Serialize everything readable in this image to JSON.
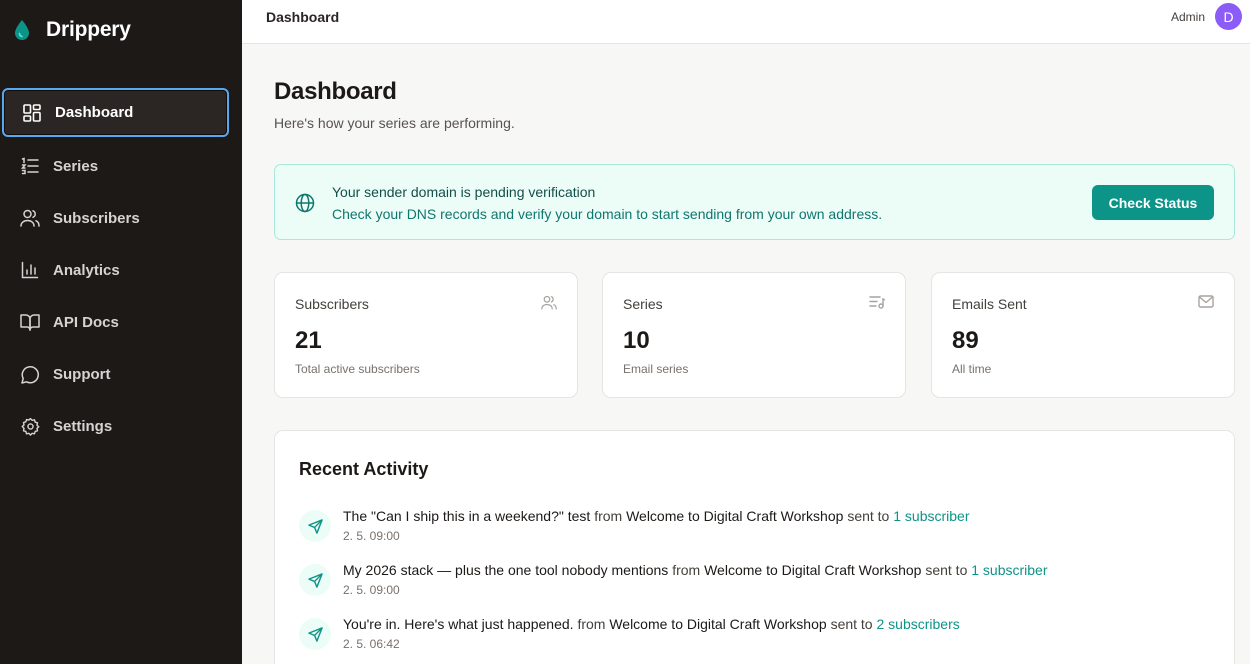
{
  "brand": {
    "name": "Drippery",
    "accent": "#0d9488"
  },
  "sidebar": {
    "items": [
      {
        "label": "Dashboard",
        "icon": "dashboard-grid-icon",
        "active": true
      },
      {
        "label": "Series",
        "icon": "list-ordered-icon"
      },
      {
        "label": "Subscribers",
        "icon": "users-icon"
      },
      {
        "label": "Analytics",
        "icon": "bar-chart-icon"
      },
      {
        "label": "API Docs",
        "icon": "book-open-icon"
      },
      {
        "label": "Support",
        "icon": "message-circle-icon"
      },
      {
        "label": "Settings",
        "icon": "gear-icon"
      }
    ]
  },
  "topbar": {
    "title": "Dashboard",
    "user_name": "Admin",
    "avatar_initial": "D",
    "avatar_color": "#8b5cf6"
  },
  "page": {
    "title": "Dashboard",
    "subtitle": "Here's how your series are performing."
  },
  "alert": {
    "title": "Your sender domain is pending verification",
    "body": "Check your DNS records and verify your domain to start sending from your own address.",
    "button": "Check Status",
    "icon": "globe-icon"
  },
  "stats": [
    {
      "label": "Subscribers",
      "value": "21",
      "caption": "Total active subscribers",
      "icon": "users-icon"
    },
    {
      "label": "Series",
      "value": "10",
      "caption": "Email series",
      "icon": "list-music-icon"
    },
    {
      "label": "Emails Sent",
      "value": "89",
      "caption": "All time",
      "icon": "mail-icon"
    }
  ],
  "activity": {
    "title": "Recent Activity",
    "items": [
      {
        "email": "The \"Can I ship this in a weekend?\" test",
        "from_word": "from",
        "series": "Welcome to Digital Craft Workshop",
        "sent_word": "sent to",
        "recipients": "1 subscriber",
        "time": "2. 5. 09:00"
      },
      {
        "email": "My 2026 stack — plus the one tool nobody mentions",
        "from_word": "from",
        "series": "Welcome to Digital Craft Workshop",
        "sent_word": "sent to",
        "recipients": "1 subscriber",
        "time": "2. 5. 09:00"
      },
      {
        "email": "You're in. Here's what just happened.",
        "from_word": "from",
        "series": "Welcome to Digital Craft Workshop",
        "sent_word": "sent to",
        "recipients": "2 subscribers",
        "time": "2. 5. 06:42"
      }
    ]
  }
}
